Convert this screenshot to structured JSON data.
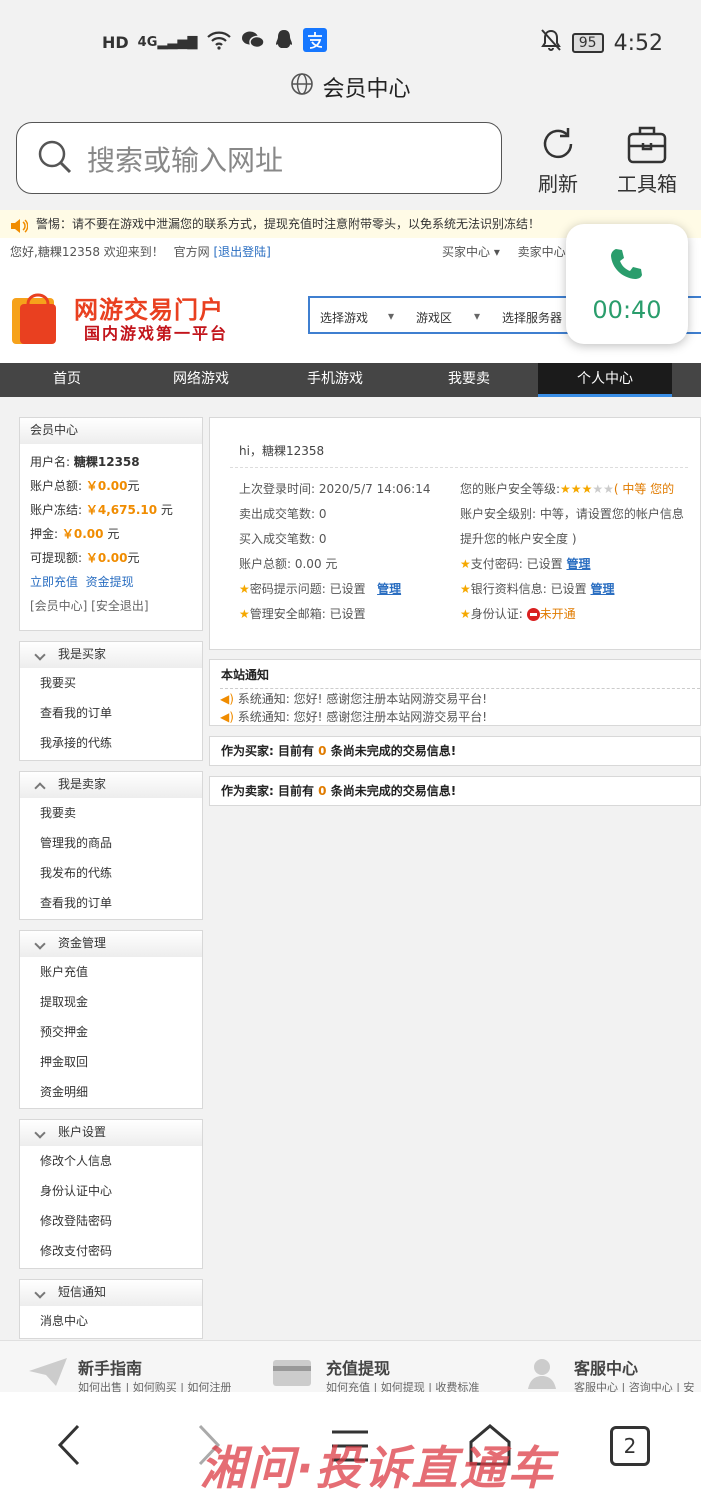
{
  "status": {
    "hd": "HD",
    "net": "4G",
    "battery": "95",
    "time": "4:52"
  },
  "browser": {
    "title": "会员中心",
    "search_placeholder": "搜索或输入网址",
    "refresh": "刷新",
    "toolbox": "工具箱"
  },
  "warning": "警惕：请不要在游戏中泄漏您的联系方式，提现充值时注意附带零头，以免系统无法识别冻结！",
  "topnav": {
    "greeting": "您好,糖粿12358 欢迎来到！",
    "official": "官方网",
    "logout": "[退出登陆]",
    "buyer": "买家中心 ▾",
    "seller": "卖家中心"
  },
  "logo": {
    "title": "网游交易门户",
    "sub": "国内游戏第一平台"
  },
  "selectors": {
    "game": "选择游戏",
    "zone": "游戏区",
    "server": "选择服务器"
  },
  "call": {
    "timer": "00:40",
    "color": "#2a9d6c"
  },
  "mainnav": [
    "首页",
    "网络游戏",
    "手机游戏",
    "我要卖",
    "个人中心"
  ],
  "account": {
    "title": "会员中心",
    "username_label": "用户名:",
    "username": "糖粿12358",
    "total_label": "账户总额:",
    "total": "￥0.00",
    "total_unit": "元",
    "frozen_label": "账户冻结:",
    "frozen": "￥4,675.10",
    "frozen_unit": "元",
    "deposit_label": "押金:",
    "deposit": "￥0.00",
    "deposit_unit": "元",
    "withdraw_label": "可提现额:",
    "withdraw": "￥0.00",
    "withdraw_unit": "元",
    "recharge": "立即充值",
    "cashout": "资金提现",
    "links": "[会员中心] [安全退出]"
  },
  "menus": [
    {
      "title": "我是买家",
      "items": [
        "我要买",
        "查看我的订单",
        "我承接的代练"
      ]
    },
    {
      "title": "我是卖家",
      "items": [
        "我要卖",
        "管理我的商品",
        "我发布的代练",
        "查看我的订单"
      ]
    },
    {
      "title": "资金管理",
      "items": [
        "账户充值",
        "提取现金",
        "预交押金",
        "押金取回",
        "资金明细"
      ]
    },
    {
      "title": "账户设置",
      "items": [
        "修改个人信息",
        "身份认证中心",
        "修改登陆密码",
        "修改支付密码"
      ]
    },
    {
      "title": "短信通知",
      "items": [
        "消息中心"
      ]
    }
  ],
  "info": {
    "hi": "hi，糖粿12358",
    "last_login": "上次登录时间:  2020/5/7 14:06:14",
    "sold": "卖出成交笔数:  0",
    "bought": "买入成交笔数:  0",
    "total": "账户总额:    0.00 元",
    "pwd_hint": "密码提示问题:  已设置",
    "email": "管理安全邮箱:  已设置",
    "sec_level_label": "您的账户安全等级:",
    "sec_level": "( 中等 您的",
    "sec_desc1": "账户安全级别: 中等，请设置您的帐户信息",
    "sec_desc2": "提升您的帐户安全度 )",
    "pay_pwd": "支付密码:  已设置",
    "bank": "银行资料信息:  已设置",
    "id_auth": "身份认证:",
    "id_status": "未开通",
    "manage": "管理",
    "stars": "3 of 5"
  },
  "notice": {
    "title": "本站通知",
    "items": [
      "系统通知:  您好! 感谢您注册本站网游交易平台!",
      "系统通知:  您好! 感谢您注册本站网游交易平台!"
    ]
  },
  "buyer_msg": {
    "pre": "作为买家: 目前有 ",
    "count": "0",
    "post": " 条尚未完成的交易信息!"
  },
  "seller_msg": {
    "pre": "作为卖家: 目前有 ",
    "count": "0",
    "post": " 条尚未完成的交易信息!"
  },
  "footer": [
    {
      "title": "新手指南",
      "links": "如何出售 | 如何购买 | 如何注册"
    },
    {
      "title": "充值提现",
      "links": "如何充值 | 如何提现 | 收费标准"
    },
    {
      "title": "客服中心",
      "links": "客服中心 | 咨询中心 | 安"
    }
  ],
  "tabs_count": "2",
  "watermark": "湘问·投诉直通车"
}
